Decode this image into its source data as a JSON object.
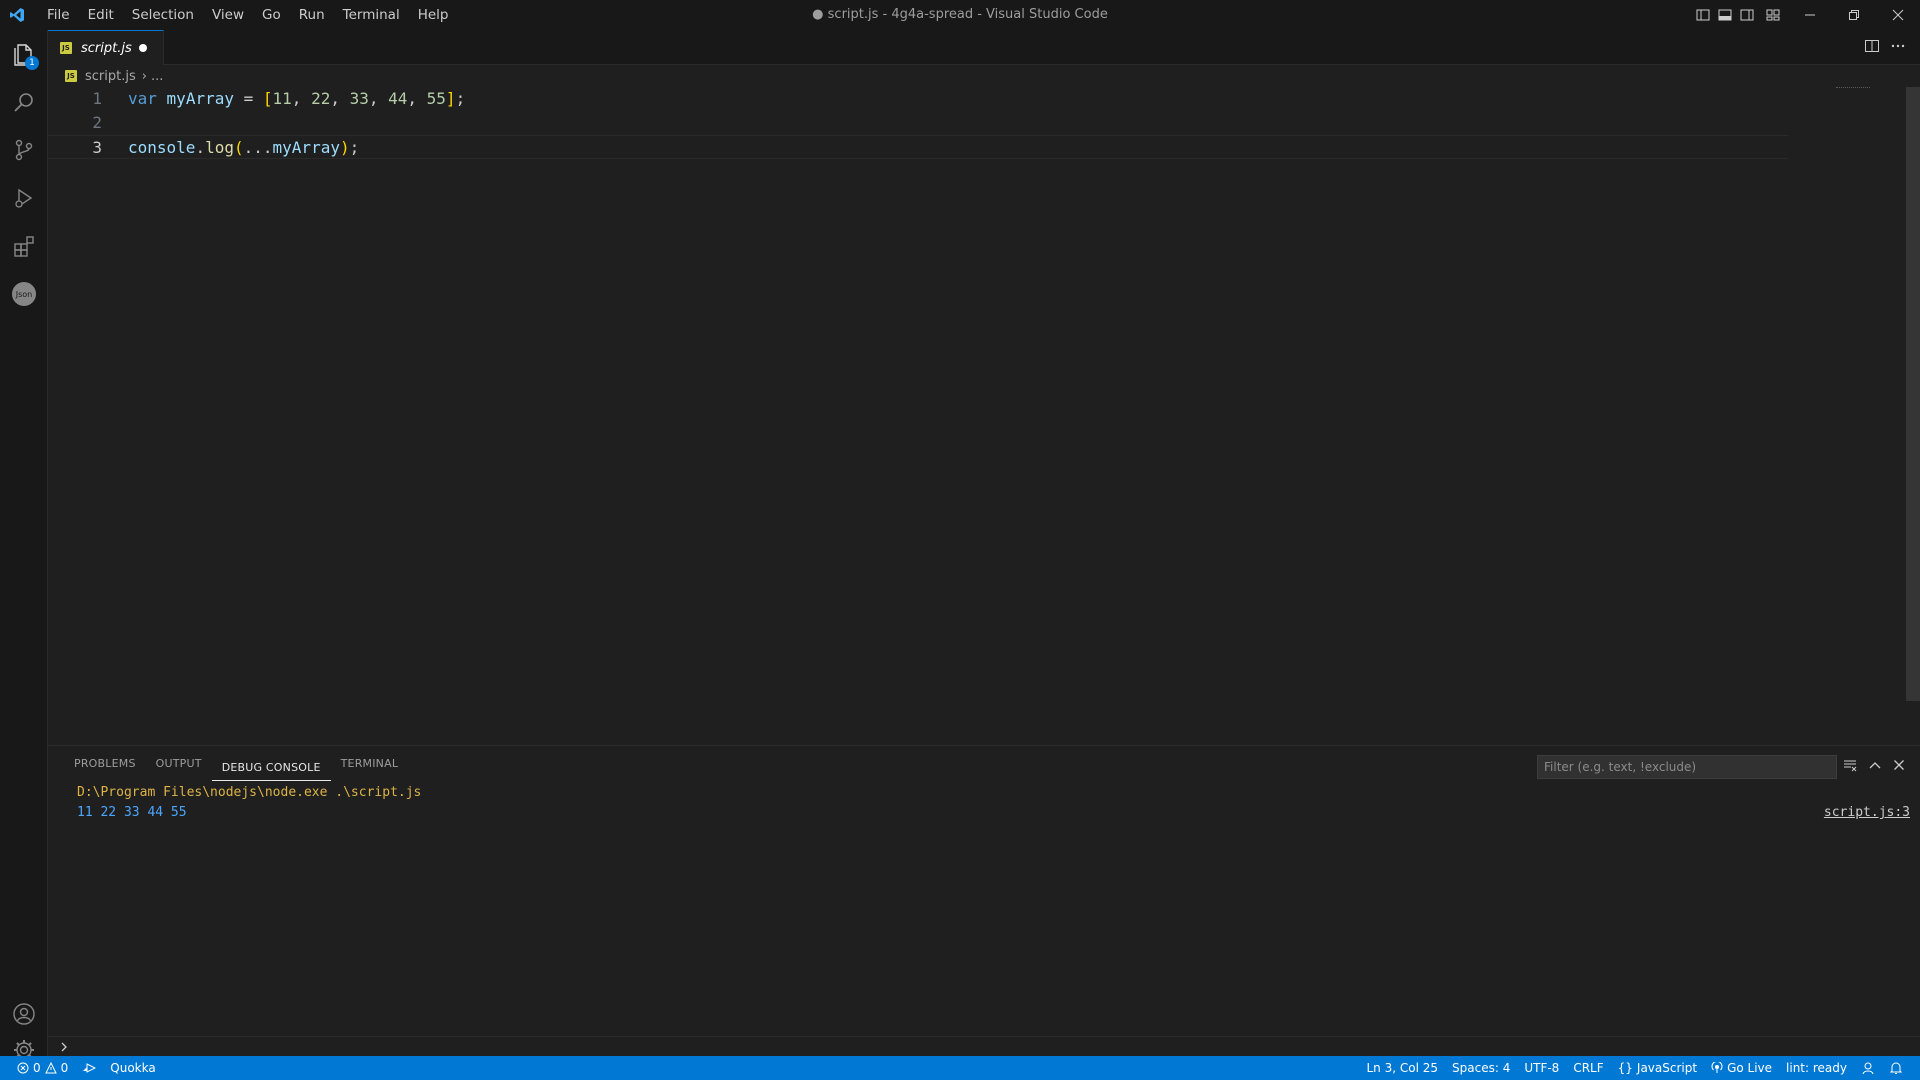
{
  "window": {
    "title": "● script.js - 4g4a-spread - Visual Studio Code"
  },
  "menu": [
    "File",
    "Edit",
    "Selection",
    "View",
    "Go",
    "Run",
    "Terminal",
    "Help"
  ],
  "activity": {
    "explorer_badge": "1",
    "json_label": "Json"
  },
  "tab": {
    "label": "script.js",
    "icon_text": "JS"
  },
  "breadcrumb": {
    "file": "script.js",
    "rest": "..."
  },
  "editor": {
    "lines": [
      {
        "number": "1",
        "tokens": [
          [
            "kw",
            "var"
          ],
          [
            "txt",
            " "
          ],
          [
            "var",
            "myArray"
          ],
          [
            "txt",
            " = "
          ],
          [
            "br",
            "["
          ],
          [
            "num",
            "11"
          ],
          [
            "txt",
            ", "
          ],
          [
            "num",
            "22"
          ],
          [
            "txt",
            ", "
          ],
          [
            "num",
            "33"
          ],
          [
            "txt",
            ", "
          ],
          [
            "num",
            "44"
          ],
          [
            "txt",
            ", "
          ],
          [
            "num",
            "55"
          ],
          [
            "br",
            "]"
          ],
          [
            "txt",
            ";"
          ]
        ]
      },
      {
        "number": "2",
        "tokens": []
      },
      {
        "number": "3",
        "tokens": [
          [
            "var",
            "console"
          ],
          [
            "txt",
            "."
          ],
          [
            "fn",
            "log"
          ],
          [
            "br",
            "("
          ],
          [
            "txt",
            "..."
          ],
          [
            "var",
            "myArray"
          ],
          [
            "br",
            ")"
          ],
          [
            "txt",
            ";"
          ]
        ]
      }
    ]
  },
  "panel": {
    "tabs": [
      "PROBLEMS",
      "OUTPUT",
      "DEBUG CONSOLE",
      "TERMINAL"
    ],
    "active_tab": "DEBUG CONSOLE",
    "filter_placeholder": "Filter (e.g. text, !exclude)",
    "console": {
      "command": "D:\\Program Files\\nodejs\\node.exe .\\script.js",
      "output": "11 22 33 44 55",
      "source": "script.js:3"
    }
  },
  "status": {
    "errors": "0",
    "warnings": "0",
    "quokka": "Quokka",
    "position": "Ln 3, Col 25",
    "spaces": "Spaces: 4",
    "encoding": "UTF-8",
    "eol": "CRLF",
    "language": "JavaScript",
    "golive": "Go Live",
    "lint": "lint: ready"
  },
  "colors": {
    "accent": "#0078d4",
    "status_bg": "#0078d4",
    "editor_bg": "#1f1f1f",
    "chrome_bg": "#181818"
  }
}
